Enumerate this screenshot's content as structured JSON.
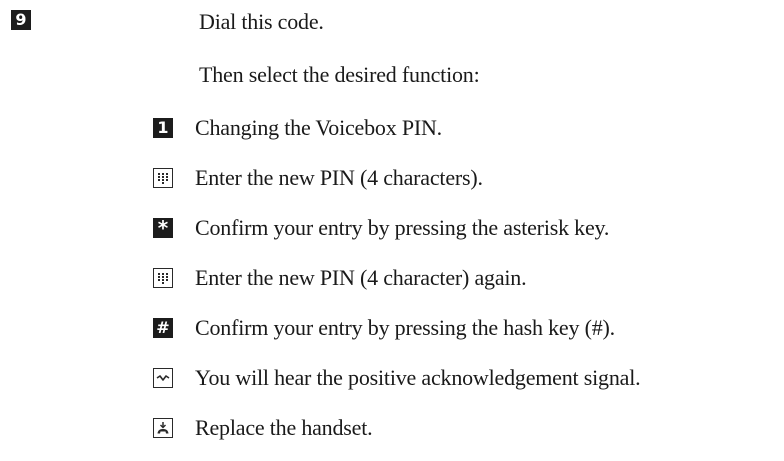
{
  "step": {
    "key": "9",
    "instruction": "Dial this code.",
    "subinstruction": "Then select the desired function:"
  },
  "items": [
    {
      "icon": "key-1-icon",
      "key": "1",
      "text": "Changing the Voicebox PIN."
    },
    {
      "icon": "keypad-icon",
      "text": "Enter the new PIN (4 characters)."
    },
    {
      "icon": "asterisk-key-icon",
      "key": "*",
      "text": "Confirm your entry by pressing the asterisk key."
    },
    {
      "icon": "keypad-icon",
      "text": "Enter the new PIN (4 character) again."
    },
    {
      "icon": "hash-key-icon",
      "key": "#",
      "text": "Confirm your entry by pressing the hash key (#)."
    },
    {
      "icon": "acknowledgement-tone-icon",
      "text": "You will hear the positive acknowledgement signal."
    },
    {
      "icon": "replace-handset-icon",
      "text": "Replace the handset."
    }
  ]
}
